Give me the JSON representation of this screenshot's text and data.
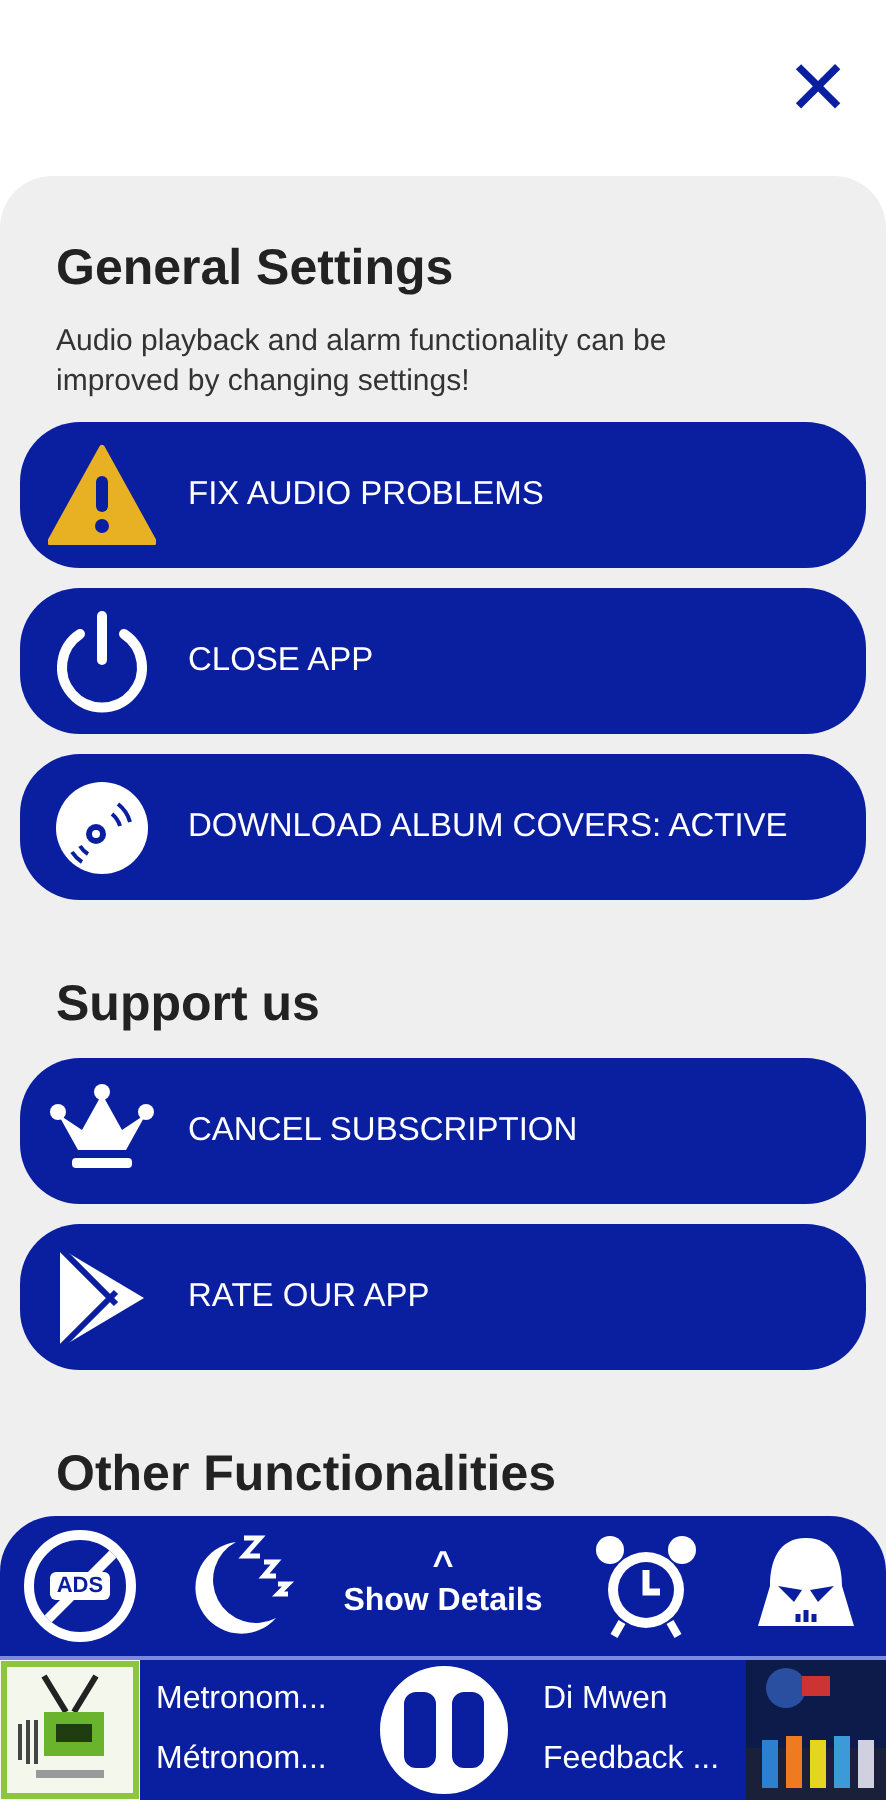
{
  "close_button": {
    "symbol": "✕"
  },
  "sections": [
    {
      "title": "General Settings",
      "description": "Audio playback and alarm functionality can be improved by changing settings!",
      "buttons": [
        {
          "label": "FIX AUDIO PROBLEMS",
          "kind": "warning"
        },
        {
          "label": "CLOSE APP",
          "kind": "power"
        },
        {
          "label": "DOWNLOAD ALBUM COVERS: ACTIVE",
          "kind": "disc"
        }
      ]
    },
    {
      "title": "Support us",
      "buttons": [
        {
          "label": "CANCEL SUBSCRIPTION",
          "kind": "crown"
        },
        {
          "label": "RATE OUR APP",
          "kind": "play"
        }
      ]
    },
    {
      "title": "Other Functionalities"
    }
  ],
  "toolbar": {
    "left": [
      {
        "kind": "noads",
        "label": "ADS"
      },
      {
        "kind": "sleep"
      }
    ],
    "center": {
      "symbol": "^",
      "label": "Show Details"
    },
    "right": [
      {
        "kind": "alarm"
      },
      {
        "kind": "helmet"
      }
    ]
  },
  "player": {
    "station_lines": [
      "Metronom...",
      "Métronom..."
    ],
    "track_lines": [
      "Di Mwen",
      "Feedback ..."
    ],
    "playing": true
  }
}
